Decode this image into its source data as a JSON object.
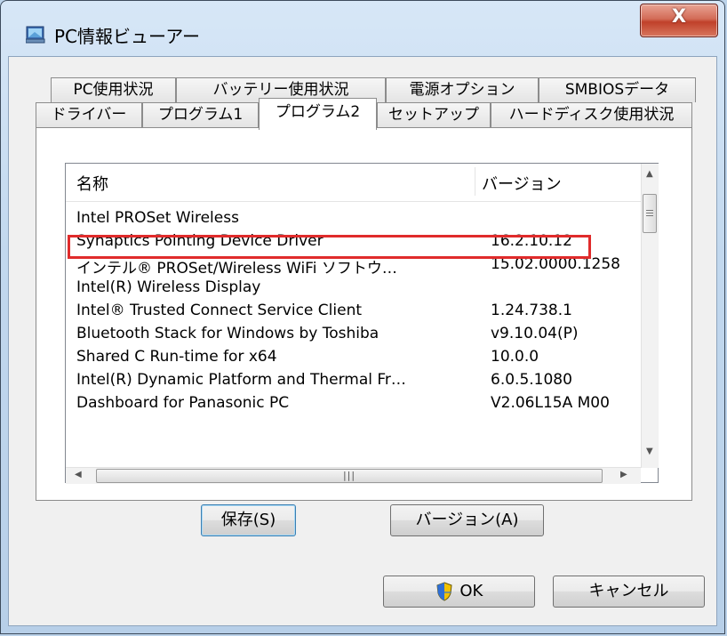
{
  "window": {
    "title": "PC情報ビューアー",
    "close_symbol": "X"
  },
  "tabs_row1": [
    "PC使用状況",
    "バッテリー使用状況",
    "電源オプション",
    "SMBIOSデータ"
  ],
  "tabs_row2": [
    "ドライバー",
    "プログラム1",
    "プログラム2",
    "セットアップ",
    "ハードディスク使用状況"
  ],
  "active_tab": "プログラム2",
  "list": {
    "col_name": "名称",
    "col_version": "バージョン",
    "rows": [
      {
        "name": "Intel PROSet Wireless",
        "version": ""
      },
      {
        "name": "Synaptics Pointing Device Driver",
        "version": "16.2.10.12"
      },
      {
        "name": "インテル® PROSet/Wireless WiFi ソフトウ…",
        "version": "15.02.0000.1258"
      },
      {
        "name": "Intel(R) Wireless Display",
        "version": ""
      },
      {
        "name": "Intel® Trusted Connect Service Client",
        "version": "1.24.738.1"
      },
      {
        "name": "Bluetooth Stack for Windows by Toshiba",
        "version": "v9.10.04(P)"
      },
      {
        "name": "Shared C Run-time for x64",
        "version": "10.0.0"
      },
      {
        "name": "Intel(R) Dynamic Platform and Thermal Fr…",
        "version": "6.0.5.1080"
      },
      {
        "name": "Dashboard for Panasonic PC",
        "version": "V2.06L15A M00"
      }
    ],
    "highlighted_row_index": 1,
    "highlight_color": "#e02b2b"
  },
  "buttons": {
    "save": "保存(S)",
    "version": "バージョン(A)",
    "ok": "OK",
    "cancel": "キャンセル"
  },
  "icons": {
    "app": "app-window-icon",
    "shield": "uac-shield-icon"
  }
}
